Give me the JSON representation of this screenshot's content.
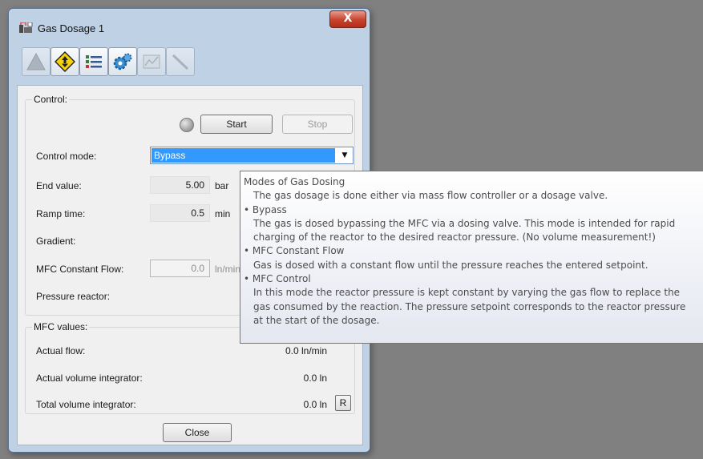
{
  "window": {
    "title": "Gas Dosage 1",
    "close_glyph": "X"
  },
  "toolbar": {
    "buttons": [
      {
        "icon": "warning-icon",
        "enabled": false
      },
      {
        "icon": "arrows-diamond-icon",
        "enabled": true
      },
      {
        "icon": "list-icon",
        "enabled": true
      },
      {
        "icon": "gears-icon",
        "enabled": true
      },
      {
        "icon": "chart-icon",
        "enabled": false
      },
      {
        "icon": "ramp-icon",
        "enabled": false
      }
    ]
  },
  "control": {
    "group_label": "Control:",
    "start_label": "Start",
    "stop_label": "Stop",
    "mode_label": "Control mode:",
    "mode_value": "Bypass",
    "end_value_label": "End value:",
    "end_value": "5.00",
    "end_value_unit": "bar",
    "ramp_time_label": "Ramp time:",
    "ramp_time": "0.5",
    "ramp_time_unit": "min",
    "gradient_label": "Gradient:",
    "mfc_flow_label": "MFC Constant Flow:",
    "mfc_flow_value": "0.0",
    "mfc_flow_unit": "ln/min",
    "pressure_label": "Pressure reactor:"
  },
  "mfc": {
    "group_label": "MFC values:",
    "actual_flow_label": "Actual flow:",
    "actual_flow_value": "0.0 ln/min",
    "actual_volume_label": "Actual volume integrator:",
    "actual_volume_value": "0.0 ln",
    "total_volume_label": "Total volume integrator:",
    "total_volume_value": "0.0 ln",
    "reset_label": "R"
  },
  "footer": {
    "close_label": "Close"
  },
  "tooltip": {
    "lines": [
      {
        "text": "Modes of Gas Dosing",
        "indent": false
      },
      {
        "text": "The gas dosage is done either via mass flow controller or a dosage valve.",
        "indent": true
      },
      {
        "text": "• Bypass",
        "indent": false
      },
      {
        "text": "The gas is dosed bypassing the MFC via a dosing valve. This mode is intended for rapid",
        "indent": true
      },
      {
        "text": "charging of the reactor to the desired reactor pressure. (No volume measurement!)",
        "indent": true
      },
      {
        "text": "• MFC Constant Flow",
        "indent": false
      },
      {
        "text": "Gas is dosed with a constant flow until the pressure reaches the entered setpoint.",
        "indent": true
      },
      {
        "text": "• MFC Control",
        "indent": false
      },
      {
        "text": "In this mode the reactor pressure is kept constant by varying the gas flow to replace the",
        "indent": true
      },
      {
        "text": "gas consumed by the reaction. The pressure setpoint corresponds to the reactor pressure",
        "indent": true
      },
      {
        "text": "at the start of the dosage.",
        "indent": true
      }
    ]
  }
}
